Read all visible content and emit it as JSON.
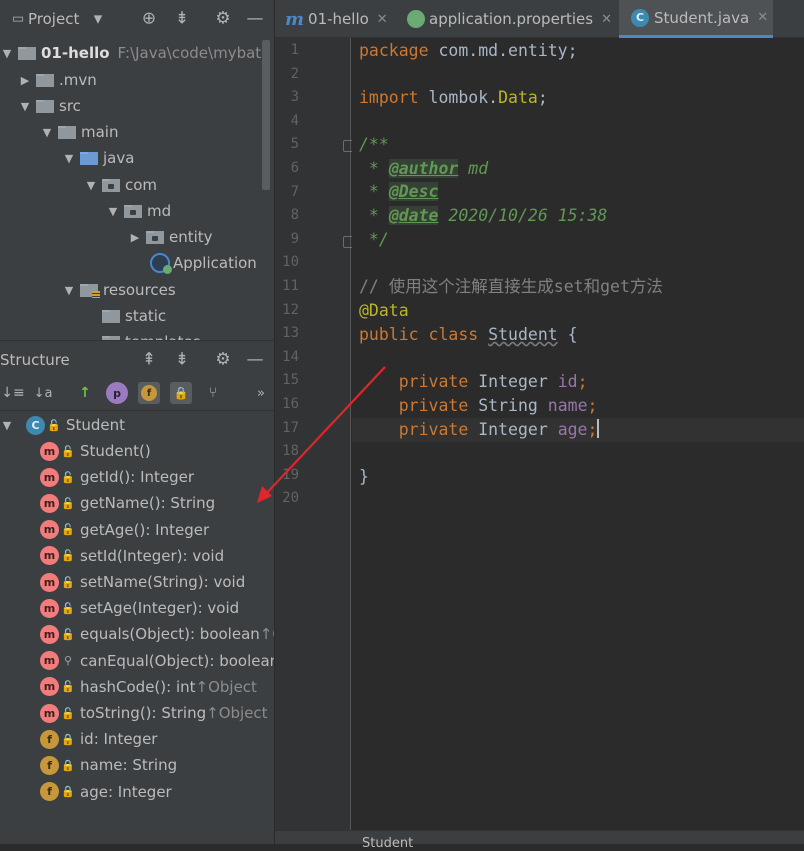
{
  "project_panel": {
    "title": "Project",
    "tree": [
      {
        "label": "01-hello",
        "path": "F:\\Java\\code\\mybatisP",
        "bold": true
      },
      {
        "label": ".mvn"
      },
      {
        "label": "src"
      },
      {
        "label": "main"
      },
      {
        "label": "java"
      },
      {
        "label": "com"
      },
      {
        "label": "md"
      },
      {
        "label": "entity"
      },
      {
        "label": "Application"
      },
      {
        "label": "resources"
      },
      {
        "label": "static"
      },
      {
        "label": "templates"
      }
    ]
  },
  "structure_panel": {
    "title": "Structure",
    "root": "Student",
    "items": [
      {
        "name": "Student()",
        "ret": ""
      },
      {
        "name": "getId(): Integer",
        "ret": ""
      },
      {
        "name": "getName(): String",
        "ret": ""
      },
      {
        "name": "getAge(): Integer",
        "ret": ""
      },
      {
        "name": "setId(Integer): void",
        "ret": ""
      },
      {
        "name": "setName(String): void",
        "ret": ""
      },
      {
        "name": "setAge(Integer): void",
        "ret": ""
      },
      {
        "name": "equals(Object): boolean ",
        "ret": "↑Object"
      },
      {
        "name": "canEqual(Object): boolean",
        "ret": ""
      },
      {
        "name": "hashCode(): int ",
        "ret": "↑Object"
      },
      {
        "name": "toString(): String ",
        "ret": "↑Object"
      },
      {
        "name": "id: Integer",
        "ret": ""
      },
      {
        "name": "name: String",
        "ret": ""
      },
      {
        "name": "age: Integer",
        "ret": ""
      }
    ]
  },
  "tabs": [
    {
      "label": "01-hello"
    },
    {
      "label": "application.properties"
    },
    {
      "label": "Student.java"
    }
  ],
  "editor": {
    "line_numbers": [
      "1",
      "2",
      "3",
      "4",
      "5",
      "6",
      "7",
      "8",
      "9",
      "10",
      "11",
      "12",
      "13",
      "14",
      "15",
      "16",
      "17",
      "18",
      "19",
      "20"
    ],
    "code": {
      "l1_kw": "package",
      "l1_rest": " com.md.entity;",
      "l3_kw": "import",
      "l3_pkg": " lombok.",
      "l3_cls": "Data",
      "l3_semi": ";",
      "l5": "/**",
      "l6_star": " * ",
      "l6_tag": "@author",
      "l6_val": " md",
      "l7_star": " * ",
      "l7_tag": "@Desc",
      "l8_star": " * ",
      "l8_tag": "@date",
      "l8_val": " 2020/10/26 15:38",
      "l9": " */",
      "l11": "// 使用这个注解直接生成set和get方法",
      "l12": "@Data",
      "l13_kw": "public class",
      "l13_name": "Student",
      "l13_brace": " {",
      "l15_kw": "    private",
      "l15_type": " Integer ",
      "l15_field": "id",
      "l15_semi": ";",
      "l16_kw": "    private",
      "l16_type": " String ",
      "l16_field": "name",
      "l16_semi": ";",
      "l17_kw": "    private",
      "l17_type": " Integer ",
      "l17_field": "age",
      "l17_semi": ";",
      "l19": "}"
    }
  },
  "status": {
    "breadcrumb": "Student"
  }
}
